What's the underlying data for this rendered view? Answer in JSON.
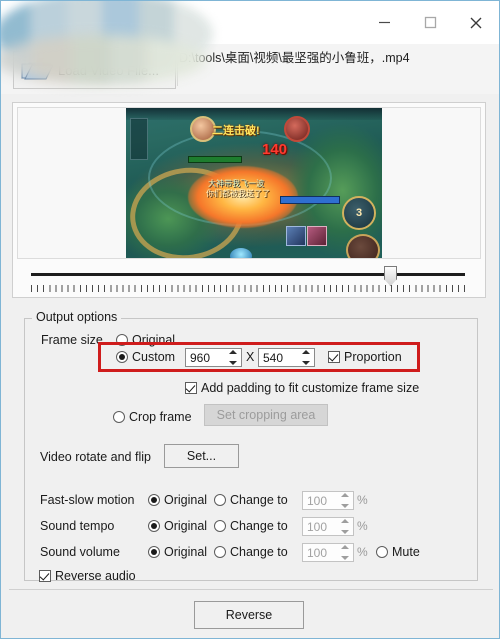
{
  "window": {
    "title": "",
    "title_obscured": true,
    "controls": {
      "minimize": "minimize-icon",
      "maximize": "maximize-icon",
      "close": "close-icon"
    }
  },
  "toolbar": {
    "load_button_label": "Load Video File...",
    "load_button_icon": "folder-icon",
    "file_path": "D:\\tools\\桌面\\视频\\最坚强的小鲁班，.mp4"
  },
  "preview": {
    "video_scene": {
      "kill_text": "二连击破!",
      "damage_text": "140",
      "skill_count": "3",
      "chat_line_1": "大神带我飞一波",
      "chat_line_2": "你们都被我送了了"
    },
    "trackbar": {
      "name": "video-position-slider",
      "position_percent": 85
    }
  },
  "output_options": {
    "group_label": "Output options",
    "frame_size": {
      "label": "Frame size",
      "original_label": "Original",
      "original_selected": false,
      "custom_label": "Custom",
      "custom_selected": true,
      "width_value": "960",
      "separator": "X",
      "height_value": "540",
      "proportion_label": "Proportion",
      "proportion_checked": true,
      "padding_label": "Add padding to fit customize frame size",
      "padding_checked": true,
      "crop_label": "Crop frame",
      "crop_selected": false,
      "crop_button_label": "Set cropping area",
      "crop_button_enabled": false
    },
    "rotate_flip": {
      "label": "Video rotate and flip",
      "button_label": "Set..."
    },
    "fast_slow_motion": {
      "label": "Fast-slow motion",
      "original_label": "Original",
      "original_selected": true,
      "change_label": "Change to",
      "change_selected": false,
      "value": "100",
      "unit": "%"
    },
    "sound_tempo": {
      "label": "Sound tempo",
      "original_label": "Original",
      "original_selected": true,
      "change_label": "Change to",
      "change_selected": false,
      "value": "100",
      "unit": "%"
    },
    "sound_volume": {
      "label": "Sound volume",
      "original_label": "Original",
      "original_selected": true,
      "change_label": "Change to",
      "change_selected": false,
      "value": "100",
      "unit": "%",
      "mute_label": "Mute",
      "mute_selected": false
    },
    "reverse_audio": {
      "label": "Reverse audio",
      "checked": true
    }
  },
  "footer": {
    "reverse_button_label": "Reverse"
  },
  "annotation": {
    "highlight_color": "#cf1c1c",
    "highlight_target": "custom-frame-size-row"
  }
}
